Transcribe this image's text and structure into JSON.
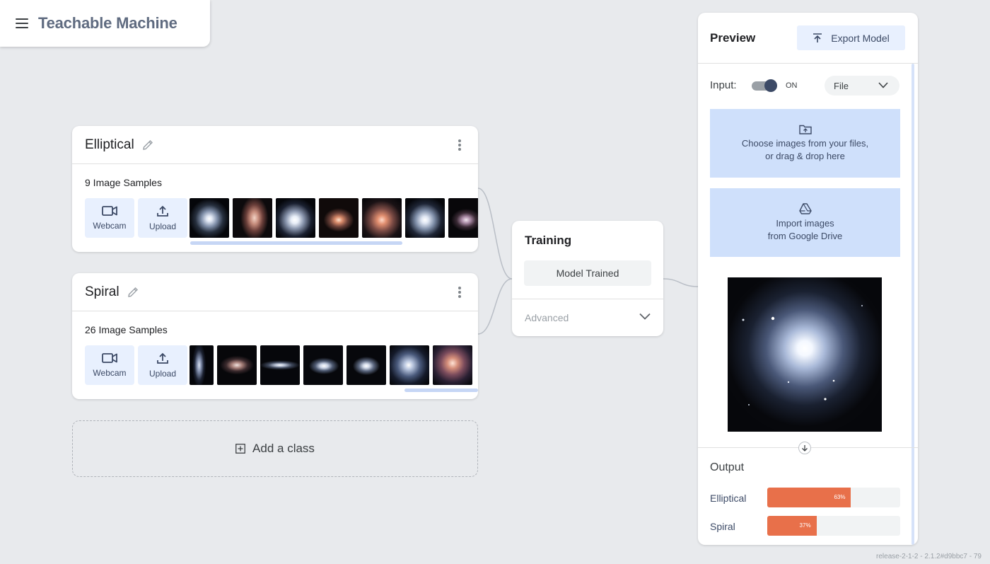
{
  "header": {
    "brand": "Teachable Machine"
  },
  "classes": [
    {
      "name": "Elliptical",
      "samples_label": "9 Image Samples",
      "webcam_label": "Webcam",
      "upload_label": "Upload"
    },
    {
      "name": "Spiral",
      "samples_label": "26 Image Samples",
      "webcam_label": "Webcam",
      "upload_label": "Upload"
    }
  ],
  "add_class": {
    "label": "Add a class"
  },
  "training": {
    "title": "Training",
    "button_label": "Model Trained",
    "advanced_label": "Advanced"
  },
  "preview": {
    "title": "Preview",
    "export_label": "Export Model",
    "input_label": "Input:",
    "toggle_state": "ON",
    "input_source": "File",
    "file_drop": {
      "line1": "Choose images from your files,",
      "line2": "or drag & drop here"
    },
    "drive_import": {
      "line1": "Import images",
      "line2": "from Google Drive"
    },
    "output_title": "Output",
    "outputs": [
      {
        "label": "Elliptical",
        "percent": 63,
        "percent_text": "63%"
      },
      {
        "label": "Spiral",
        "percent": 37,
        "percent_text": "37%"
      }
    ]
  },
  "colors": {
    "accent": "#e8704a",
    "panel_blue": "#cfe0fb",
    "button_blue": "#e8f0fe",
    "brand": "#5f6b80"
  },
  "footer": {
    "version": "release-2-1-2 - 2.1.2#d9bbc7 - 79"
  }
}
